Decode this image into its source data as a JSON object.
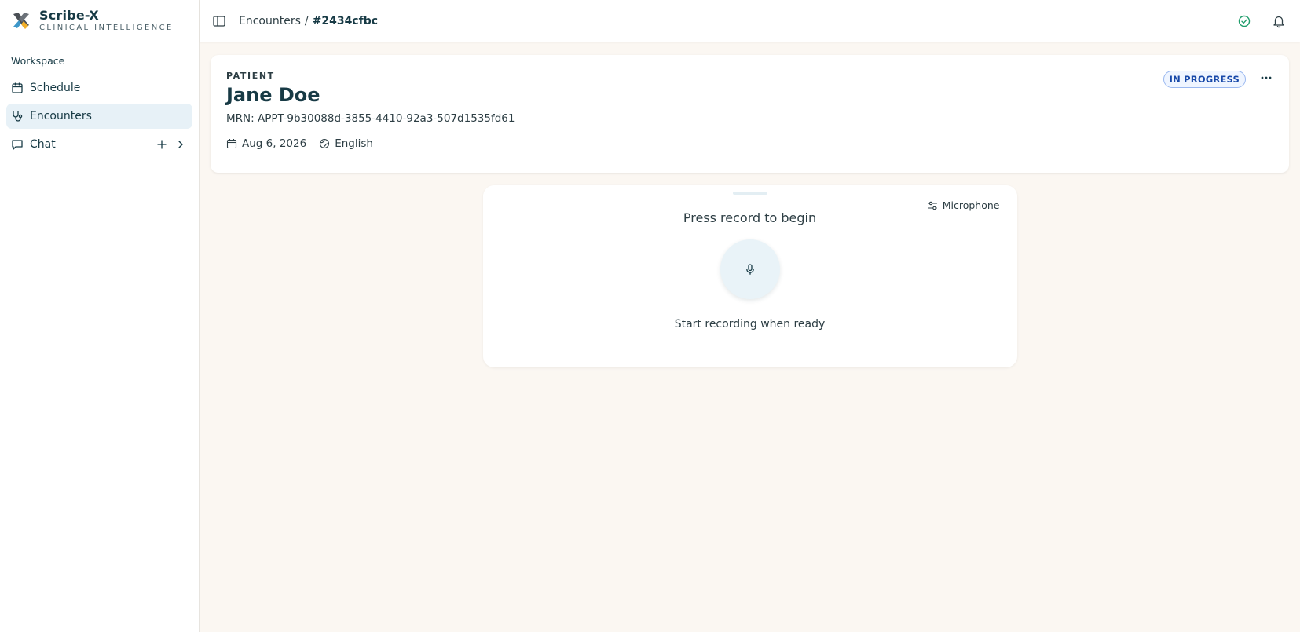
{
  "brand": {
    "name": "Scribe-X",
    "subtitle": "CLINICAL INTELLIGENCE"
  },
  "sidebar": {
    "section_label": "Workspace",
    "items": [
      {
        "label": "Schedule",
        "icon": "calendar-icon",
        "active": false
      },
      {
        "label": "Encounters",
        "icon": "stethoscope-icon",
        "active": true
      },
      {
        "label": "Chat",
        "icon": "chat-icon",
        "active": false
      }
    ]
  },
  "topbar": {
    "breadcrumb": {
      "parent": "Encounters",
      "separator": "/",
      "current": "#2434cfbc"
    }
  },
  "patient": {
    "overline": "PATIENT",
    "name": "Jane Doe",
    "mrn": "MRN: APPT-9b30088d-3855-4410-92a3-507d1535fd61",
    "date": "Aug 6, 2026",
    "language": "English",
    "status": "IN PROGRESS"
  },
  "recorder": {
    "prompt": "Press record to begin",
    "hint": "Start recording when ready",
    "mic_label": "Microphone"
  },
  "colors": {
    "accent": "#173a45",
    "active_nav_bg": "#e7f1f7",
    "status_text": "#1849a9",
    "status_bg": "#eff5ff",
    "page_bg": "#fbf7f2",
    "ok_green": "#1f9d6b"
  }
}
